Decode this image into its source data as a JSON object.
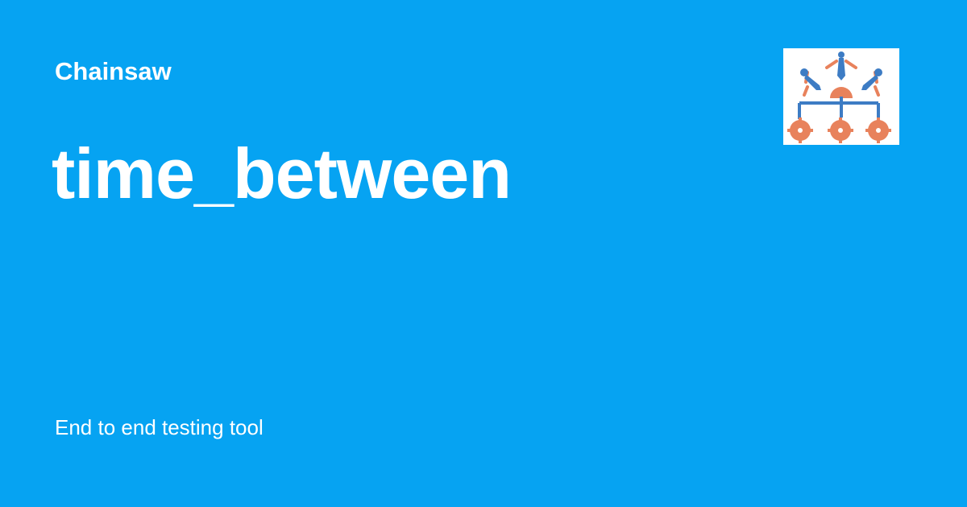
{
  "brand": {
    "name": "Chainsaw",
    "logo_icon": "chainsaw-logo-icon"
  },
  "page": {
    "title": "time_between",
    "tagline": "End to end testing tool"
  },
  "colors": {
    "background": "#06a3f2",
    "text": "#ffffff",
    "logo_orange": "#e8825c",
    "logo_blue": "#3d7cc4"
  }
}
